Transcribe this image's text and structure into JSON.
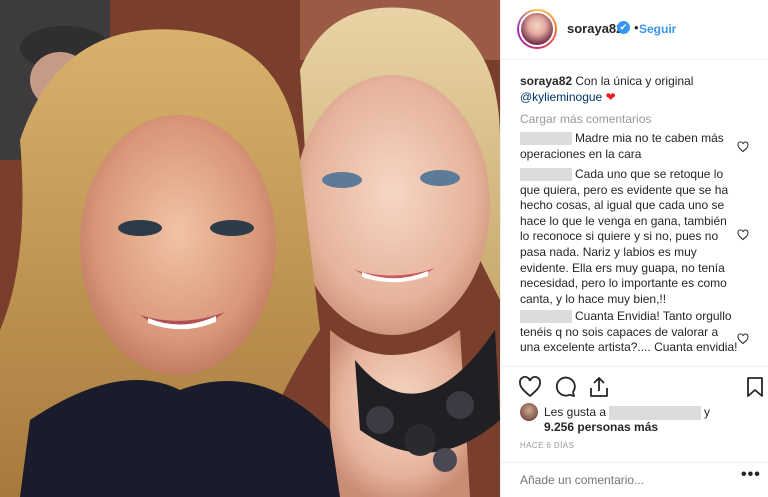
{
  "post": {
    "username": "soraya82",
    "verified_badge": "✔",
    "separator": "•",
    "follow_label": "Seguir"
  },
  "caption": {
    "username": "soraya82",
    "text": " Con la única y original ",
    "mention": "@kylieminogue",
    "emoji": "❤"
  },
  "load_more": "Cargar más comentarios",
  "comments": [
    {
      "text": "Madre mia no te caben más operaciones en la cara"
    },
    {
      "text": "Cada uno que se retoque lo que quiera, pero es evidente que se ha hecho cosas, al igual que cada uno se hace lo que le venga en gana, también lo reconoce si quiere y si no, pues no pasa nada. Nariz y labios es muy evidente. Ella ers muy guapa, no tenía necesidad, pero lo importante es como canta, y lo hace muy bien,!!"
    },
    {
      "text": "Cuanta Envidia! Tanto orgullo tenéis q no sois capaces de valorar a una excelente artista?.... Cuanta envidia!"
    }
  ],
  "likes": {
    "prefix": "Les gusta a",
    "suffix": "y",
    "others": "9.256 personas más"
  },
  "timestamp": "HACE 6 DÍAS",
  "add_comment": {
    "placeholder": "Añade un comentario...",
    "options": "•••"
  },
  "icons": {
    "like": "heart-icon",
    "comment": "comment-icon",
    "share": "share-icon",
    "save": "bookmark-icon",
    "verified": "verified-icon"
  },
  "colors": {
    "link": "#3897f0",
    "mention": "#003569",
    "muted": "#999999",
    "text": "#262626",
    "heart": "#ed1c24"
  }
}
